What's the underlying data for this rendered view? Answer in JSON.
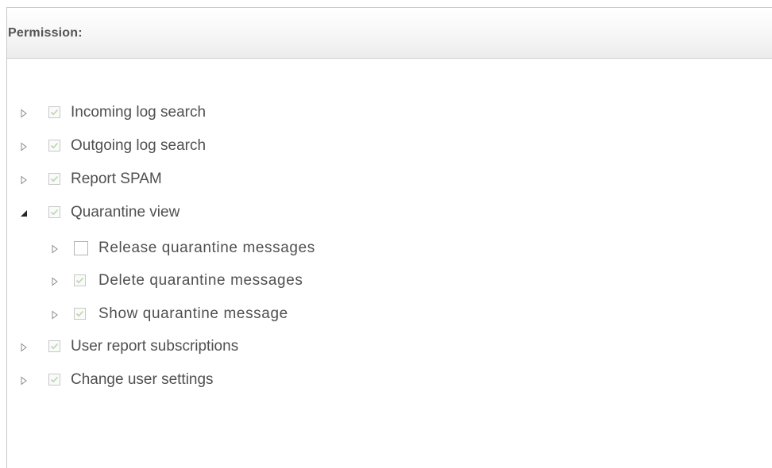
{
  "panel": {
    "title": "Permission:"
  },
  "tree": [
    {
      "label": "Incoming log search",
      "checked": true,
      "expanded": false,
      "level": 0
    },
    {
      "label": "Outgoing log search",
      "checked": true,
      "expanded": false,
      "level": 0
    },
    {
      "label": "Report SPAM",
      "checked": true,
      "expanded": false,
      "level": 0
    },
    {
      "label": "Quarantine view",
      "checked": true,
      "expanded": true,
      "level": 0
    },
    {
      "label": "Release quarantine messages",
      "checked": false,
      "expanded": false,
      "level": 1
    },
    {
      "label": "Delete quarantine messages",
      "checked": true,
      "expanded": false,
      "level": 1
    },
    {
      "label": "Show quarantine message",
      "checked": true,
      "expanded": false,
      "level": 1
    },
    {
      "label": "User report subscriptions",
      "checked": true,
      "expanded": false,
      "level": 0
    },
    {
      "label": "Change user settings",
      "checked": true,
      "expanded": false,
      "level": 0
    }
  ],
  "icons": {
    "collapsed": "triangle-right-outline-icon",
    "expanded": "triangle-down-filled-icon",
    "checked": "checkmark-icon"
  },
  "colors": {
    "text": "#505050",
    "check": "#b8d8a8",
    "header_text": "#555555",
    "border": "#c9c9c9"
  }
}
